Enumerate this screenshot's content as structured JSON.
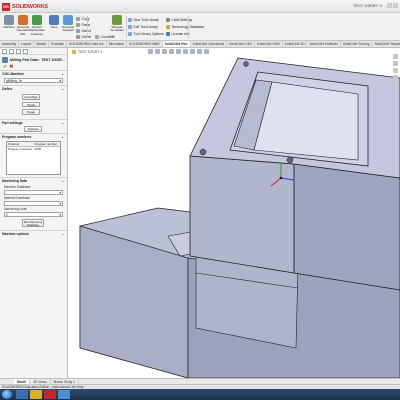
{
  "app": {
    "brand_prefix": "DS",
    "brand_name": "SOLIDWORKS",
    "doc_title": "TEST 3/2DRY X"
  },
  "ribbon": {
    "buttons": [
      {
        "label": "Machine",
        "icon": "machine-icon",
        "color": "#7c8fa8"
      },
      {
        "label": "Generate Operation Plan",
        "icon": "generate-plan-icon",
        "color": "#d2702a"
      },
      {
        "label": "Extract Machinable Features",
        "icon": "extract-features-icon",
        "color": "#4a9a4a"
      },
      {
        "label": "Save",
        "icon": "save-icon",
        "color": "#4f7bbf"
      },
      {
        "label": "Generate Toolpath",
        "icon": "toolpath-icon",
        "color": "#5a9bd8"
      },
      {
        "label": "Manage Templates",
        "icon": "templates-icon",
        "color": "#6c9a3d"
      }
    ],
    "small_buttons": [
      {
        "label": "Copy",
        "icon": "copy-icon",
        "color": "#8aa"
      },
      {
        "label": "Paste",
        "icon": "paste-icon",
        "color": "#a98"
      },
      {
        "label": "Select",
        "icon": "select-icon",
        "color": "#99b"
      },
      {
        "label": "Delete",
        "icon": "delete-icon",
        "color": "#b88"
      },
      {
        "label": "CoordMill",
        "icon": "coord-icon",
        "color": "#9a9"
      },
      {
        "label": "New Tool Library",
        "icon": "new-library-icon",
        "color": "#7aa6d8"
      },
      {
        "label": "Edit Tool Library",
        "icon": "edit-library-icon",
        "color": "#7aa6d8"
      },
      {
        "label": "Tool Library Options",
        "icon": "library-options-icon",
        "color": "#7aa6d8"
      },
      {
        "label": "CAM Settings",
        "icon": "settings-icon",
        "color": "#888"
      },
      {
        "label": "Technology Database",
        "icon": "database-icon",
        "color": "#c9a33a"
      },
      {
        "label": "License Info",
        "icon": "info-icon",
        "color": "#5577aa"
      }
    ]
  },
  "tabs": [
    {
      "label": "Assembly"
    },
    {
      "label": "Layout"
    },
    {
      "label": "Sketch"
    },
    {
      "label": "Evaluate"
    },
    {
      "label": "SOLIDWORKS Add-Ins"
    },
    {
      "label": "Simulation"
    },
    {
      "label": "SOLIDWORKS MBD"
    },
    {
      "label": "SolidCAM Part"
    },
    {
      "label": "SolidCAM Operations"
    },
    {
      "label": "SolidCAM 2.5D"
    },
    {
      "label": "SolidCAM HSM"
    },
    {
      "label": "SolidCAM 3D"
    },
    {
      "label": "SolidCAM Multiaxis"
    },
    {
      "label": "SolidCAM Turning"
    },
    {
      "label": "SolidCAM Templates"
    }
  ],
  "panel": {
    "title": "Milling Part Data : TEST 3/2DR...",
    "sections": {
      "cnc_machine": "CNC-Machine",
      "define": "Define",
      "part_settings": "Part settings",
      "program_numbers": "Program numbers",
      "machining_data": "Machining Data",
      "machine_options": "Machine options"
    },
    "machine_value": "gMilling_3x",
    "define_buttons": [
      "CoordSys",
      "Stock",
      "Target"
    ],
    "settings_button": "Settings",
    "program_table": {
      "headers": [
        "Channel",
        "Program number"
      ],
      "rows": [
        [
          "Program numbers",
          "0000"
        ]
      ]
    },
    "machining_fields": [
      {
        "label": "Machine Database",
        "value": ""
      },
      {
        "label": "Material Database",
        "value": ""
      },
      {
        "label": "Machining Level",
        "value": "0"
      }
    ],
    "edit_button": "Edit Machining Database"
  },
  "viewport": {
    "breadcrumb": "TEST 3/2DRY X"
  },
  "bottom_tabs": [
    "Model",
    "3D Views",
    "Motion Study 1"
  ],
  "status": "SOLIDWORKS Education Edition - Instructional Use Only"
}
